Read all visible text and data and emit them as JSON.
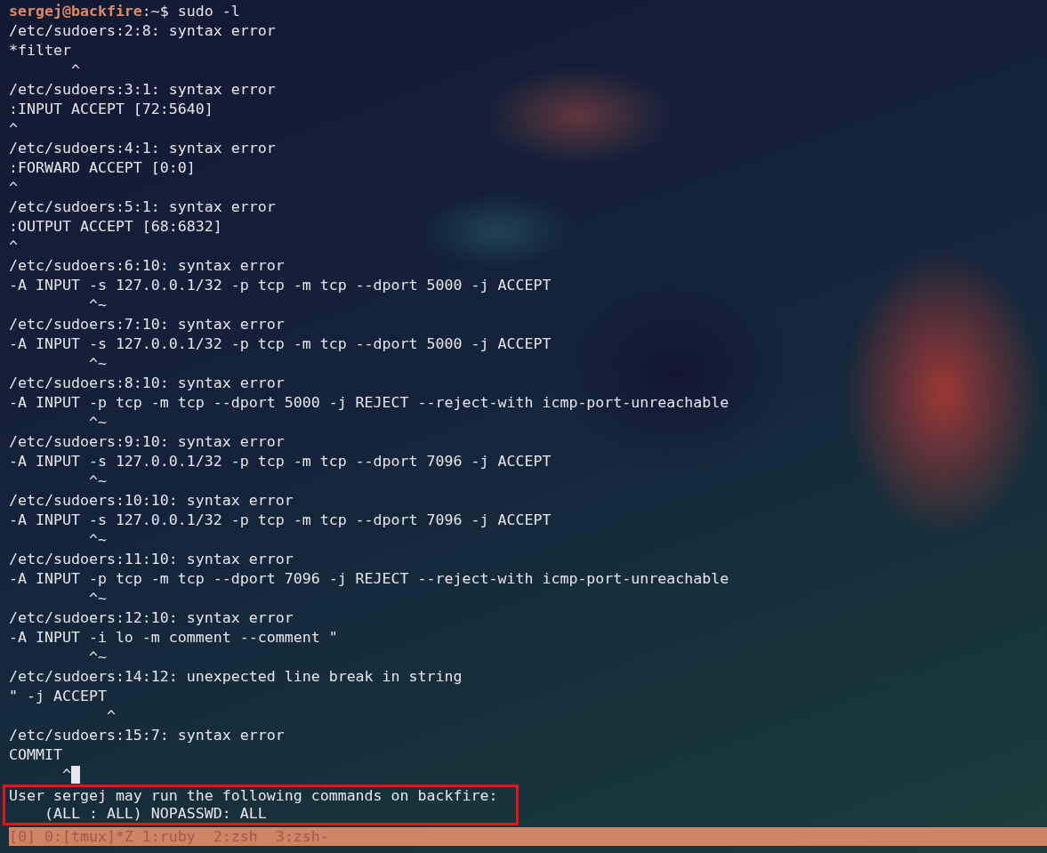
{
  "terminal": {
    "prompt": {
      "user_host": "sergej@backfire",
      "path": ":~$",
      "command": " sudo -l"
    },
    "lines": [
      {
        "text": "/etc/sudoers:2:8: syntax error",
        "cursor": false
      },
      {
        "text": "*filter",
        "cursor": false
      },
      {
        "text": "       ^",
        "cursor": false
      },
      {
        "text": "/etc/sudoers:3:1: syntax error",
        "cursor": false
      },
      {
        "text": ":INPUT ACCEPT [72:5640]",
        "cursor": false
      },
      {
        "text": "^",
        "cursor": false
      },
      {
        "text": "/etc/sudoers:4:1: syntax error",
        "cursor": false
      },
      {
        "text": ":FORWARD ACCEPT [0:0]",
        "cursor": false
      },
      {
        "text": "^",
        "cursor": false
      },
      {
        "text": "/etc/sudoers:5:1: syntax error",
        "cursor": false
      },
      {
        "text": ":OUTPUT ACCEPT [68:6832]",
        "cursor": false
      },
      {
        "text": "^",
        "cursor": false
      },
      {
        "text": "/etc/sudoers:6:10: syntax error",
        "cursor": false
      },
      {
        "text": "-A INPUT -s 127.0.0.1/32 -p tcp -m tcp --dport 5000 -j ACCEPT",
        "cursor": false
      },
      {
        "text": "         ^~",
        "cursor": false
      },
      {
        "text": "/etc/sudoers:7:10: syntax error",
        "cursor": false
      },
      {
        "text": "-A INPUT -s 127.0.0.1/32 -p tcp -m tcp --dport 5000 -j ACCEPT",
        "cursor": false
      },
      {
        "text": "         ^~",
        "cursor": false
      },
      {
        "text": "/etc/sudoers:8:10: syntax error",
        "cursor": false
      },
      {
        "text": "-A INPUT -p tcp -m tcp --dport 5000 -j REJECT --reject-with icmp-port-unreachable",
        "cursor": false
      },
      {
        "text": "         ^~",
        "cursor": false
      },
      {
        "text": "/etc/sudoers:9:10: syntax error",
        "cursor": false
      },
      {
        "text": "-A INPUT -s 127.0.0.1/32 -p tcp -m tcp --dport 7096 -j ACCEPT",
        "cursor": false
      },
      {
        "text": "         ^~",
        "cursor": false
      },
      {
        "text": "/etc/sudoers:10:10: syntax error",
        "cursor": false
      },
      {
        "text": "-A INPUT -s 127.0.0.1/32 -p tcp -m tcp --dport 7096 -j ACCEPT",
        "cursor": false
      },
      {
        "text": "         ^~",
        "cursor": false
      },
      {
        "text": "/etc/sudoers:11:10: syntax error",
        "cursor": false
      },
      {
        "text": "-A INPUT -p tcp -m tcp --dport 7096 -j REJECT --reject-with icmp-port-unreachable",
        "cursor": false
      },
      {
        "text": "         ^~",
        "cursor": false
      },
      {
        "text": "/etc/sudoers:12:10: syntax error",
        "cursor": false
      },
      {
        "text": "-A INPUT -i lo -m comment --comment \"",
        "cursor": false
      },
      {
        "text": "         ^~",
        "cursor": false
      },
      {
        "text": "/etc/sudoers:14:12: unexpected line break in string",
        "cursor": false
      },
      {
        "text": "\" -j ACCEPT",
        "cursor": false
      },
      {
        "text": "           ^",
        "cursor": false
      },
      {
        "text": "/etc/sudoers:15:7: syntax error",
        "cursor": false
      },
      {
        "text": "COMMIT",
        "cursor": false
      },
      {
        "text": "      ^",
        "cursor": true
      }
    ],
    "highlighted_lines": [
      {
        "text": "User sergej may run the following commands on backfire:"
      },
      {
        "text": "    (ALL : ALL) NOPASSWD: ALL"
      }
    ]
  },
  "status_bar": {
    "text": "[0] 0:[tmux]*Z 1:ruby  2:zsh  3:zsh-"
  }
}
